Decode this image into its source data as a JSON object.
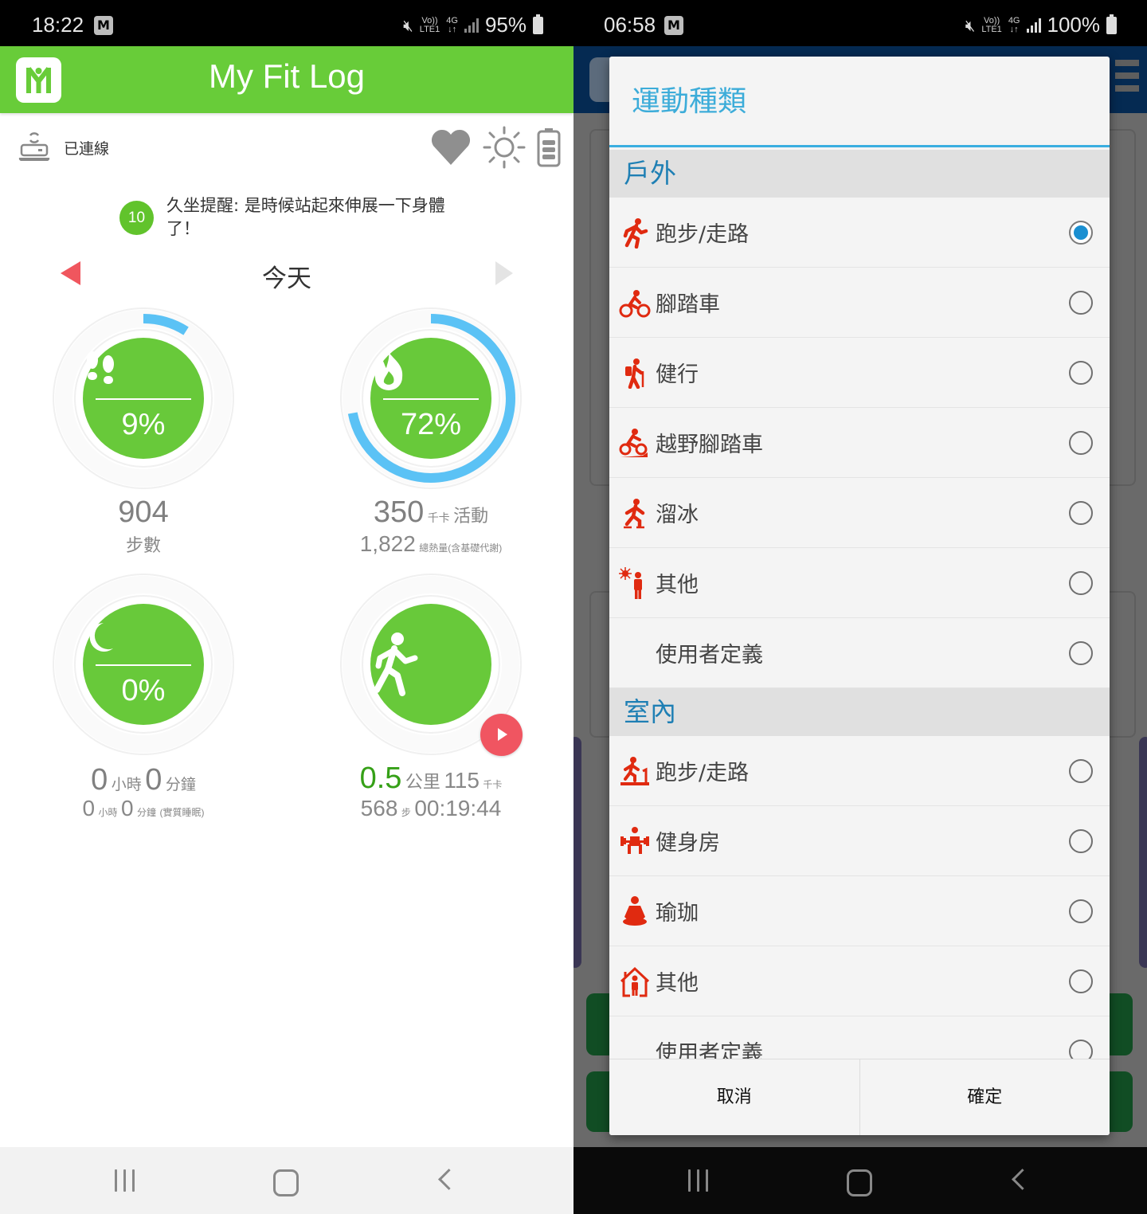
{
  "left": {
    "status": {
      "time": "18:22",
      "battery": "95%",
      "volte": "Vo))",
      "lte": "LTE1",
      "net": "4G"
    },
    "app": {
      "title": "My Fit Log",
      "logo": "M"
    },
    "connection": {
      "label": "已連線"
    },
    "reminder": {
      "count": "10",
      "text": "久坐提醒: 是時候站起來伸展一下身體了！"
    },
    "date": {
      "label": "今天"
    },
    "rings": {
      "steps": {
        "percent_label": "9%",
        "progress": 0.09,
        "value": "904",
        "label": "步數"
      },
      "calories": {
        "percent_label": "72%",
        "progress": 0.72,
        "value": "350",
        "unit": "千卡",
        "unit2": "活動",
        "total": "1,822",
        "total_label": "總熱量(含基礎代謝)"
      },
      "sleep": {
        "percent_label": "0%",
        "progress": 0,
        "hours": "0",
        "hours_unit": "小時",
        "minutes": "0",
        "minutes_unit": "分鐘",
        "real_hours": "0",
        "real_minutes": "0",
        "real_label": "(實質睡眠)"
      },
      "workout": {
        "distance": "0.5",
        "distance_unit": "公里",
        "kcal": "115",
        "kcal_unit": "千卡",
        "steps": "568",
        "steps_unit": "步",
        "duration": "00:19:44"
      }
    },
    "colors": {
      "brand_green": "#68cc39",
      "ring_blue": "#5bc2f5",
      "play_red": "#f05561"
    }
  },
  "right": {
    "status": {
      "time": "06:58",
      "battery": "100%",
      "volte": "Vo))",
      "lte": "LTE1",
      "net": "4G"
    },
    "dialog": {
      "title": "運動種類",
      "sections": [
        {
          "name": "戶外",
          "items": [
            {
              "label": "跑步/走路",
              "icon": "running-icon",
              "checked": true
            },
            {
              "label": "腳踏車",
              "icon": "cycling-icon",
              "checked": false
            },
            {
              "label": "健行",
              "icon": "hiking-icon",
              "checked": false
            },
            {
              "label": "越野腳踏車",
              "icon": "mountain-bike-icon",
              "checked": false
            },
            {
              "label": "溜冰",
              "icon": "skating-icon",
              "checked": false
            },
            {
              "label": "其他",
              "icon": "outdoor-other-icon",
              "checked": false
            },
            {
              "label": "使用者定義",
              "icon": "",
              "checked": false
            }
          ]
        },
        {
          "name": "室內",
          "items": [
            {
              "label": "跑步/走路",
              "icon": "treadmill-icon",
              "checked": false
            },
            {
              "label": "健身房",
              "icon": "weightlifting-icon",
              "checked": false
            },
            {
              "label": "瑜珈",
              "icon": "yoga-icon",
              "checked": false
            },
            {
              "label": "其他",
              "icon": "indoor-other-icon",
              "checked": false
            },
            {
              "label": "使用者定義",
              "icon": "",
              "checked": false
            }
          ]
        }
      ],
      "cancel": "取消",
      "confirm": "確定"
    },
    "colors": {
      "title_blue": "#3cacd9",
      "section_blue": "#1e7fb4",
      "icon_red": "#e02a10",
      "radio_blue": "#1a8fd1"
    }
  }
}
